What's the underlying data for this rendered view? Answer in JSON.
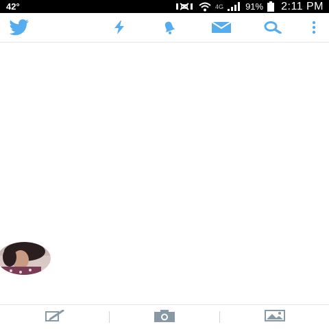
{
  "status_bar": {
    "temperature": "42°",
    "network_type": "4G",
    "battery_percent": "91%",
    "time": "2:11 PM"
  },
  "action_bar": {
    "icons": [
      "twitter-bird-icon",
      "lightning-icon",
      "bell-icon",
      "envelope-icon",
      "search-icon",
      "overflow-menu-icon"
    ],
    "accent_color": "#55acee"
  },
  "compose_bar": {
    "icons": [
      "compose-tweet-icon",
      "camera-icon",
      "image-icon"
    ],
    "icon_color": "#8899a6"
  },
  "timeline": {
    "avatar": "user-profile-photo"
  }
}
